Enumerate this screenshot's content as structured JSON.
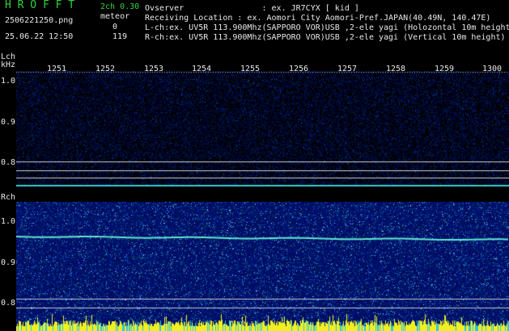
{
  "app": {
    "title": "H R O F F T",
    "mode": "2ch 0.30",
    "detect_label": "meteor"
  },
  "file": {
    "name": "2506221250.png",
    "timestamp": "25.06.22 12:50"
  },
  "counts": {
    "lch": "0",
    "rch": "119"
  },
  "info": {
    "observer": "Ovserver                : ex. JR7CYX [ kid ]",
    "location": "Receiving Location : ex. Aomori City Aomori-Pref.JAPAN(40.49N, 140.47E)",
    "lch": "L-ch:ex. UV5R 113.900Mhz(SAPPORO VOR)USB ,2-ele yagi (Holozontal 10m height",
    "rch": "R-ch:ex. UV5R 113.900Mhz(SAPPORO VOR)USB ,2-ele yagi (Vertical 10m height)"
  },
  "panels": {
    "lch_label": "Lch",
    "unit_label": "kHz",
    "rch_label": "Rch"
  },
  "time_ticks": [
    "1251",
    "1252",
    "1253",
    "1254",
    "1255",
    "1256",
    "1257",
    "1258",
    "1259",
    "1300"
  ],
  "lch_freq_ticks": [
    "1.0",
    "0.9",
    "0.8"
  ],
  "rch_freq_ticks": [
    "1.0",
    "0.9",
    "0.8"
  ],
  "colors": {
    "text_green": "#2fd23a",
    "text_white": "#e8e8e8",
    "signal_cyan": "#40e0e0",
    "noise_blue": "#1a2aa0",
    "meteor_yellow": "#ffff00"
  }
}
